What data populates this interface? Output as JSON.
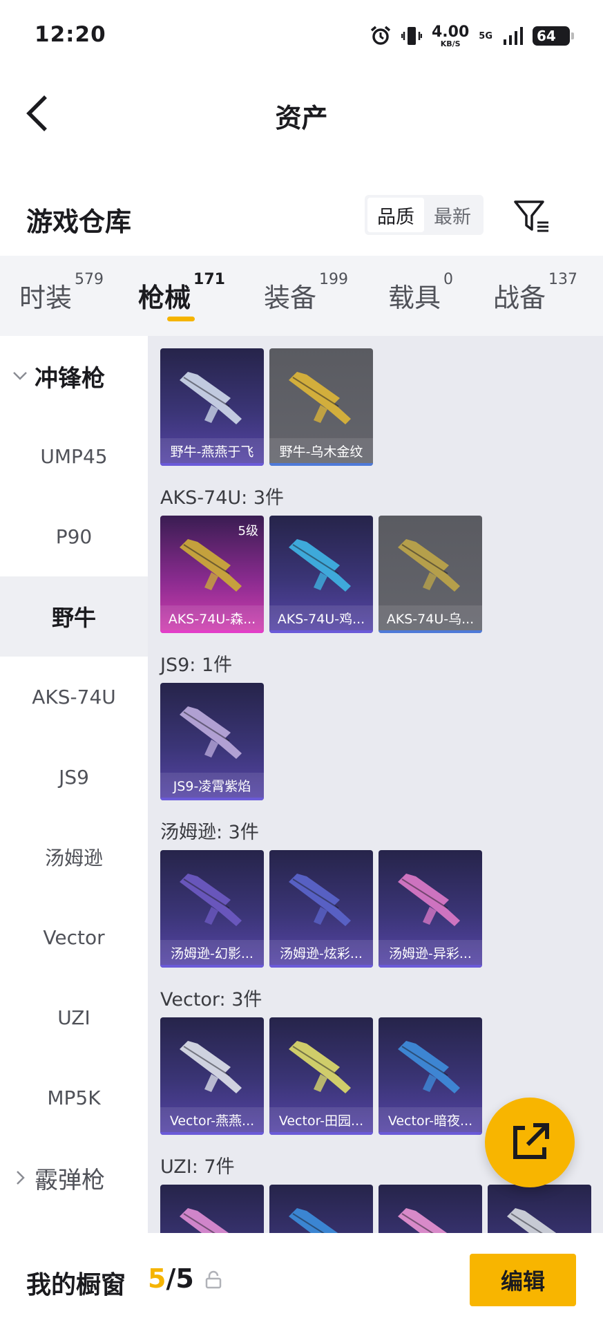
{
  "status_bar": {
    "time": "12:20",
    "speed_value": "4.00",
    "speed_unit": "KB/S",
    "network": "5G",
    "battery": "64"
  },
  "header": {
    "title": "资产"
  },
  "warehouse": {
    "title": "游戏仓库",
    "sort_options": [
      "品质",
      "最新"
    ],
    "active_sort": "品质"
  },
  "tabs": [
    {
      "label": "时装",
      "count": "579"
    },
    {
      "label": "枪械",
      "count": "171"
    },
    {
      "label": "装备",
      "count": "199"
    },
    {
      "label": "载具",
      "count": "0"
    },
    {
      "label": "战备",
      "count": "137"
    }
  ],
  "active_tab": "枪械",
  "sidebar": {
    "group_open": "冲锋枪",
    "items": [
      "UMP45",
      "P90",
      "野牛",
      "AKS-74U",
      "JS9",
      "汤姆逊",
      "Vector",
      "UZI",
      "MP5K"
    ],
    "active_item": "野牛",
    "group_closed": "霰弹枪"
  },
  "sections": [
    {
      "title": "",
      "items": [
        {
          "name": "野牛-燕燕于飞",
          "rarity": "purple"
        },
        {
          "name": "野牛-乌木金纹",
          "rarity": "gray"
        }
      ]
    },
    {
      "title": "AKS-74U: 3件",
      "items": [
        {
          "name": "AKS-74U-森...",
          "rarity": "pink",
          "level": "5级"
        },
        {
          "name": "AKS-74U-鸡...",
          "rarity": "purple"
        },
        {
          "name": "AKS-74U-乌...",
          "rarity": "gray"
        }
      ]
    },
    {
      "title": "JS9: 1件",
      "items": [
        {
          "name": "JS9-凌霄紫焰",
          "rarity": "purple"
        }
      ]
    },
    {
      "title": "汤姆逊: 3件",
      "items": [
        {
          "name": "汤姆逊-幻影...",
          "rarity": "purple"
        },
        {
          "name": "汤姆逊-炫彩...",
          "rarity": "purple"
        },
        {
          "name": "汤姆逊-异彩...",
          "rarity": "purple"
        }
      ]
    },
    {
      "title": "Vector: 3件",
      "items": [
        {
          "name": "Vector-燕燕...",
          "rarity": "purple"
        },
        {
          "name": "Vector-田园...",
          "rarity": "purple"
        },
        {
          "name": "Vector-暗夜...",
          "rarity": "purple"
        }
      ]
    },
    {
      "title": "UZI: 7件",
      "items": [
        {
          "name": "",
          "rarity": "purple"
        },
        {
          "name": "",
          "rarity": "purple"
        },
        {
          "name": "",
          "rarity": "purple"
        },
        {
          "name": "",
          "rarity": "purple"
        }
      ]
    }
  ],
  "bottom": {
    "label": "我的橱窗",
    "count_current": "5",
    "count_total": "/5",
    "edit_label": "编辑"
  },
  "colors": {
    "accent": "#f5b400",
    "purple_card": "#3b3577",
    "gray_card": "#5a5b61",
    "pink_card": "#d23fb0"
  }
}
